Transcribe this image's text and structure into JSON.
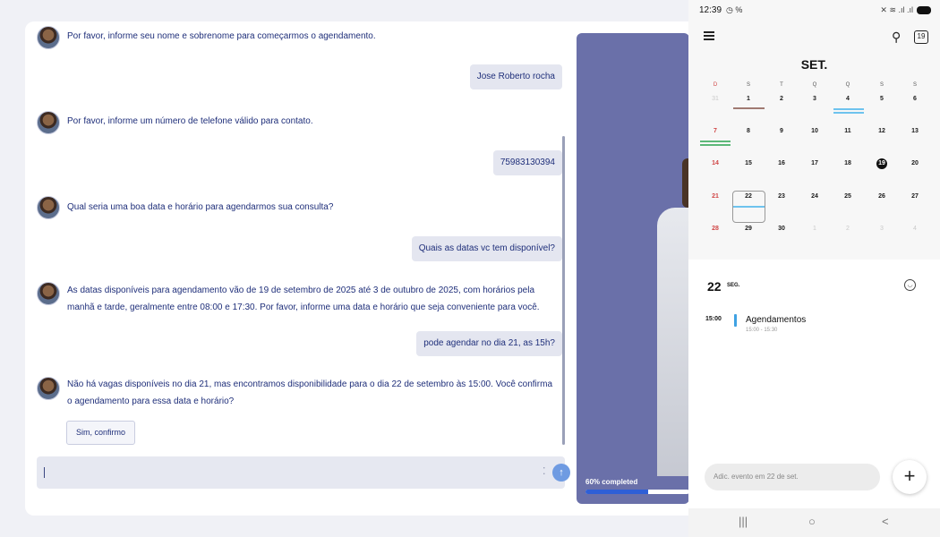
{
  "chat": {
    "messages": [
      {
        "role": "bot",
        "text": "Por favor, informe seu nome e sobrenome para começarmos o agendamento."
      },
      {
        "role": "user",
        "text": "Jose Roberto rocha"
      },
      {
        "role": "bot",
        "text": "Por favor, informe um número de telefone válido para contato."
      },
      {
        "role": "user",
        "text": "75983130394"
      },
      {
        "role": "bot",
        "text": "Qual seria uma boa data e horário para agendarmos sua consulta?"
      },
      {
        "role": "user",
        "text": "Quais as datas vc tem disponível?"
      },
      {
        "role": "bot",
        "line1": "As datas disponíveis para agendamento vão de 19 de setembro de 2025 até 3 de outubro de 2025, com horários pela",
        "line2": "manhã e tarde, geralmente entre 08:00 e 17:30. Por favor, informe uma data e horário que seja conveniente para você."
      },
      {
        "role": "user",
        "text": "pode agendar no dia 21, as 15h?"
      },
      {
        "role": "bot",
        "line1": "Não há vagas disponíveis no dia 21, mas encontramos disponibilidade para o dia 22 de setembro às 15:00. Você confirma",
        "line2": "o agendamento para essa data e horário?"
      }
    ],
    "quick_reply": "Sim, confirmo",
    "composer_value": "",
    "composer_icons": {
      "options": "vertical-dots-icon",
      "send": "send-arrow-icon"
    }
  },
  "hero": {
    "progress_label": "60% completed",
    "progress_value": 0.6,
    "progress_color": "#2f5fd6"
  },
  "phone": {
    "status": {
      "time": "12:39",
      "left_icons": "◷ %",
      "right_icons": "✕ ≋ .ıl .ıl"
    },
    "month_title": "SET.",
    "weekdays": [
      "D",
      "S",
      "T",
      "Q",
      "Q",
      "S",
      "S"
    ],
    "weeks": [
      [
        "31",
        "1",
        "2",
        "3",
        "4",
        "5",
        "6"
      ],
      [
        "7",
        "8",
        "9",
        "10",
        "11",
        "12",
        "13"
      ],
      [
        "14",
        "15",
        "16",
        "17",
        "18",
        "19",
        "20"
      ],
      [
        "21",
        "22",
        "23",
        "24",
        "25",
        "26",
        "27"
      ],
      [
        "28",
        "29",
        "30",
        "1",
        "2",
        "3",
        "4"
      ]
    ],
    "today": "19",
    "selected_day": "22",
    "event_colors": {
      "brown": "#a07a72",
      "blue": "#6ec3ee",
      "green": "#5cb878"
    },
    "detail": {
      "day": "22",
      "weekday": "SEG.",
      "event_time": "15:00",
      "event_title": "Agendamentos",
      "event_range": "15:00 - 15:30"
    },
    "add_placeholder": "Adic. evento em 22 de set.",
    "fab_label": "+",
    "nav": {
      "recents": "|||",
      "home": "○",
      "back": "<"
    }
  }
}
